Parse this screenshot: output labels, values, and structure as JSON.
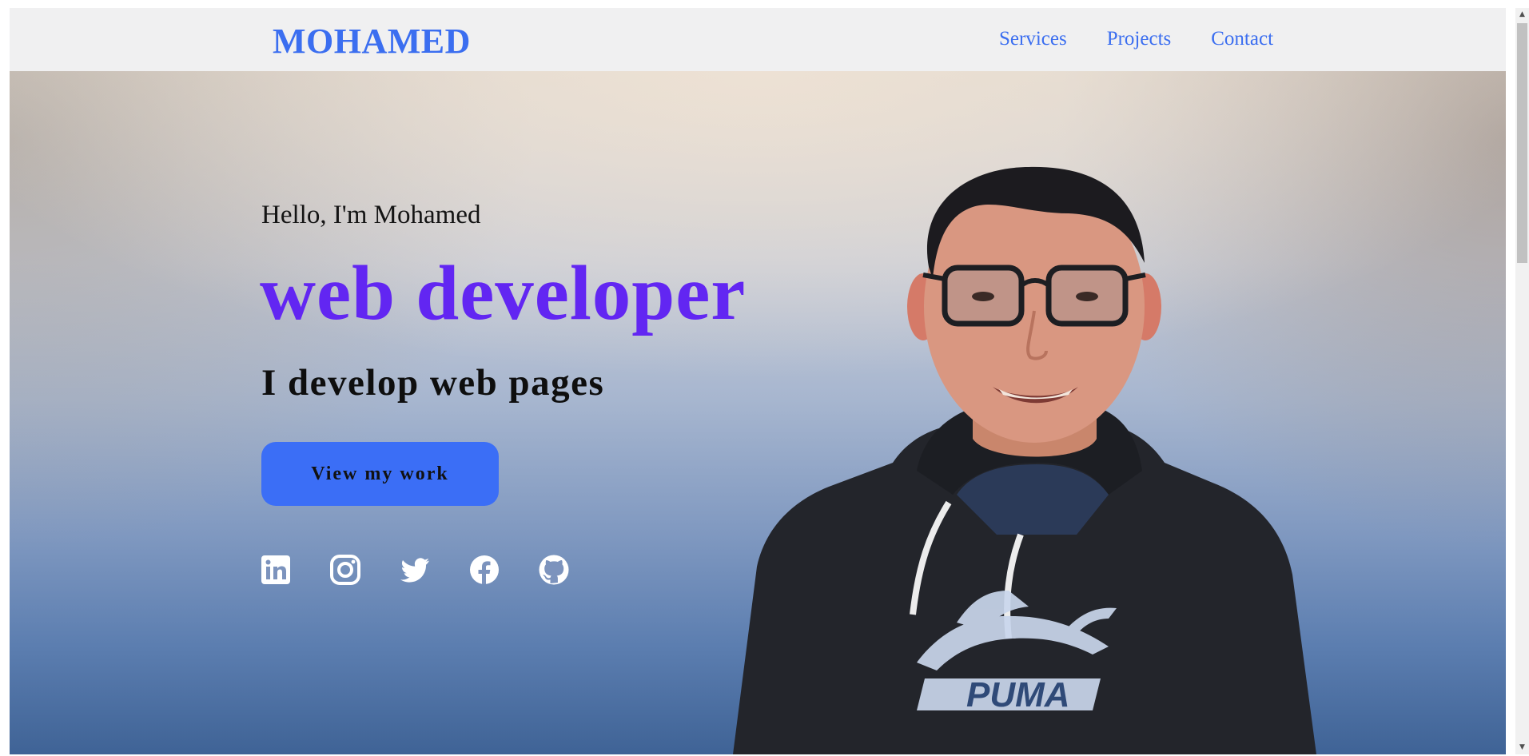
{
  "nav": {
    "brand": "MOHAMED",
    "links": [
      "Services",
      "Projects",
      "Contact"
    ]
  },
  "hero": {
    "greeting": "Hello, I'm Mohamed",
    "role": "web developer",
    "tagline": "I develop web pages",
    "cta_label": "View my work",
    "socials": [
      "linkedin-icon",
      "instagram-icon",
      "twitter-icon",
      "facebook-icon",
      "github-icon"
    ],
    "hoodie_brand": "PUMA"
  },
  "colors": {
    "accent_blue": "#3b6ef0",
    "role_purple": "#6226f2",
    "nav_background": "#f0f0f1",
    "button_blue": "#3b6ef6"
  }
}
